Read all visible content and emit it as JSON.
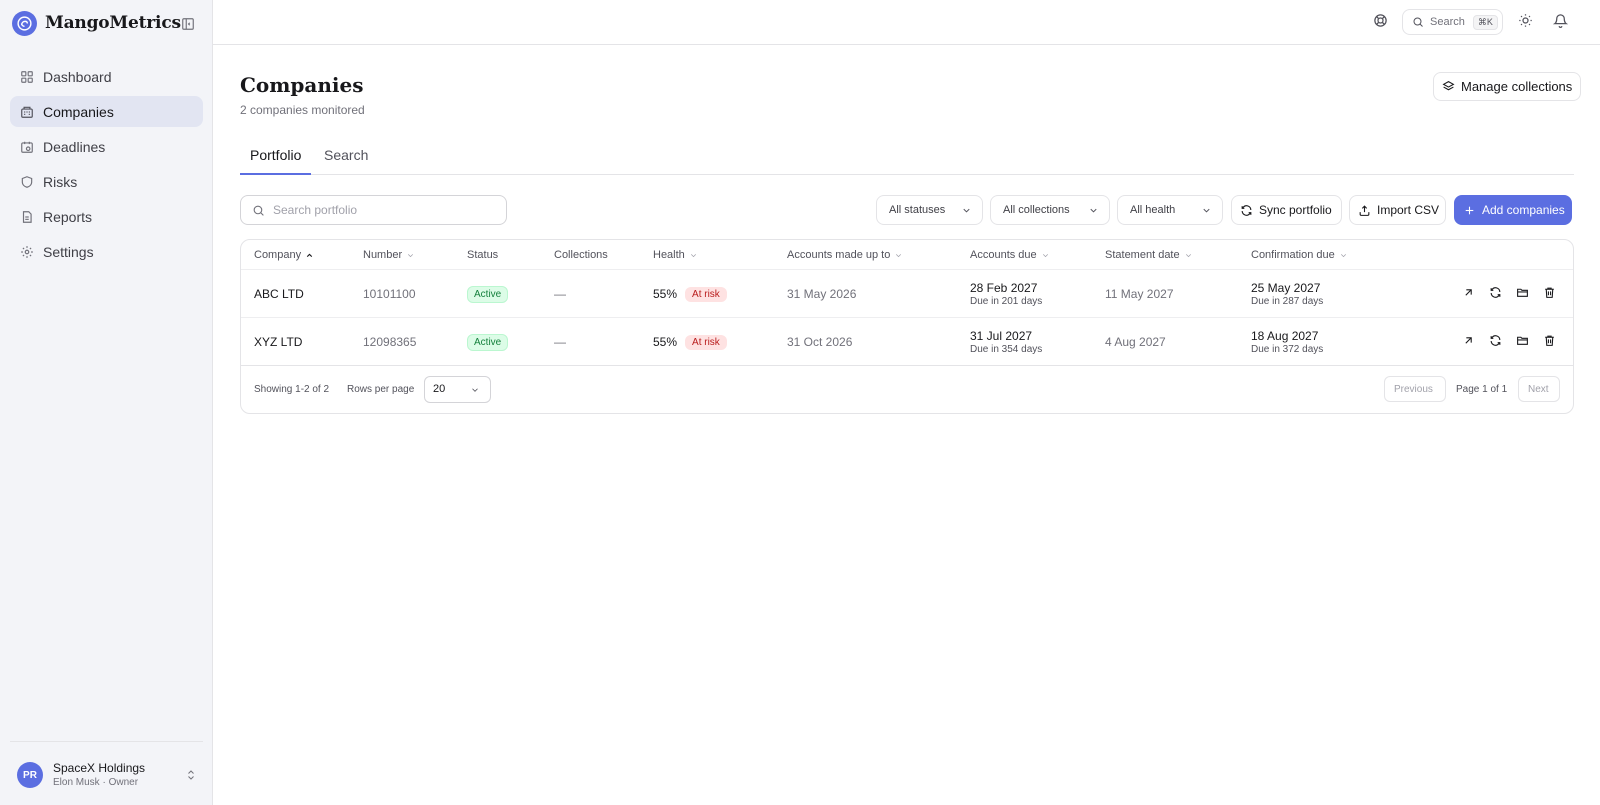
{
  "app": {
    "name": "MangoMetrics"
  },
  "sidebar": {
    "items": [
      {
        "label": "Dashboard"
      },
      {
        "label": "Companies"
      },
      {
        "label": "Deadlines"
      },
      {
        "label": "Risks"
      },
      {
        "label": "Reports"
      },
      {
        "label": "Settings"
      }
    ],
    "account": {
      "initials": "PR",
      "name": "SpaceX Holdings",
      "subtitle": "Elon Musk · Owner"
    }
  },
  "topbar": {
    "search_label": "Search",
    "shortcut": "⌘K"
  },
  "page": {
    "title": "Companies",
    "subtitle": "2 companies monitored",
    "manage_label": "Manage collections",
    "tabs": [
      {
        "label": "Portfolio"
      },
      {
        "label": "Search"
      }
    ]
  },
  "toolbar": {
    "search_placeholder": "Search portfolio",
    "filters": {
      "status": "All statuses",
      "collections": "All collections",
      "health": "All health"
    },
    "sync_label": "Sync portfolio",
    "import_label": "Import CSV",
    "add_label": "Add companies"
  },
  "table": {
    "columns": [
      "Company",
      "Number",
      "Status",
      "Collections",
      "Health",
      "Accounts made up to",
      "Accounts due",
      "Statement date",
      "Confirmation due"
    ],
    "rows": [
      {
        "company": "ABC LTD",
        "number": "10101100",
        "status": "Active",
        "collections": "—",
        "health": "55%",
        "health_flag": "At risk",
        "accounts_made_up_to": "31 May 2026",
        "accounts_due": "28 Feb 2027",
        "accounts_due_note": "Due in 201 days",
        "statement_date": "11 May 2027",
        "confirmation_due": "25 May 2027",
        "confirmation_due_note": "Due in 287 days"
      },
      {
        "company": "XYZ LTD",
        "number": "12098365",
        "status": "Active",
        "collections": "—",
        "health": "55%",
        "health_flag": "At risk",
        "accounts_made_up_to": "31 Oct 2026",
        "accounts_due": "31 Jul 2027",
        "accounts_due_note": "Due in 354 days",
        "statement_date": "4 Aug 2027",
        "confirmation_due": "18 Aug 2027",
        "confirmation_due_note": "Due in 372 days"
      }
    ],
    "footer": {
      "showing": "Showing 1-2 of 2",
      "rows_per_page_label": "Rows per page",
      "rows_per_page_value": "20",
      "previous_label": "Previous",
      "page_info": "Page 1 of 1",
      "next_label": "Next"
    }
  },
  "colors": {
    "accent": "#5b6ee1",
    "sidebar_bg": "#f3f4f8",
    "active_green": "#15803d",
    "risk_red": "#b91c1c"
  }
}
